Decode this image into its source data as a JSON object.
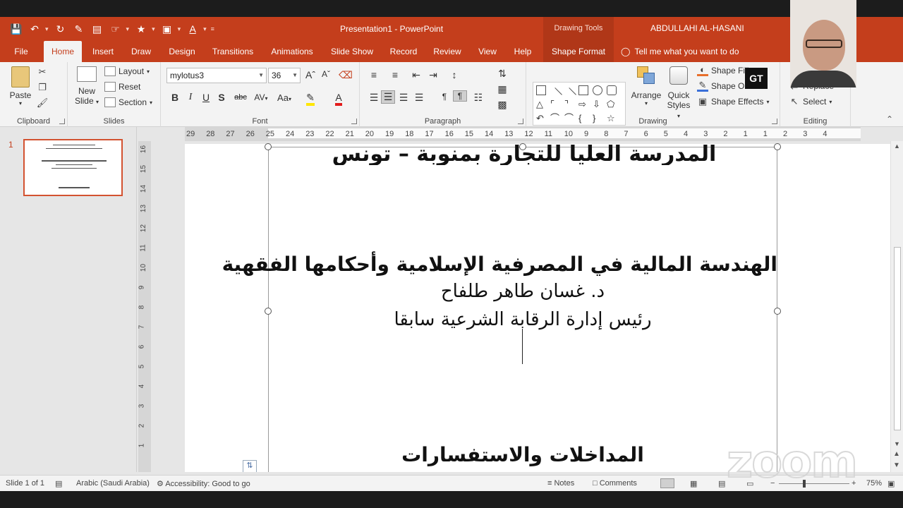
{
  "window": {
    "document_title": "Presentation1  -  PowerPoint",
    "contextual_header": "Drawing Tools",
    "user_name": "ABDULLAHI AL-HASANI"
  },
  "tabs": [
    "File",
    "Home",
    "Insert",
    "Draw",
    "Design",
    "Transitions",
    "Animations",
    "Slide Show",
    "Record",
    "Review",
    "View",
    "Help",
    "Shape Format"
  ],
  "tell_me": "Tell me what you want to do",
  "ribbon": {
    "clipboard": {
      "paste": "Paste",
      "label": "Clipboard"
    },
    "slides": {
      "new_slide": "New",
      "new_slide2": "Slide",
      "layout": "Layout",
      "reset": "Reset",
      "section": "Section",
      "label": "Slides"
    },
    "font": {
      "name": "mylotus3",
      "size": "36",
      "label": "Font",
      "bold": "B",
      "italic": "I",
      "underline": "U",
      "shadow": "S",
      "strike": "abc",
      "spacing": "AV",
      "case": "Aa"
    },
    "paragraph": {
      "label": "Paragraph"
    },
    "drawing": {
      "arrange": "Arrange",
      "quick_styles": "Quick",
      "quick_styles2": "Styles",
      "shape_fill": "Shape Fill",
      "shape_outline": "Shape Outline",
      "shape_effects": "Shape Effects",
      "label": "Drawing"
    },
    "editing": {
      "replace": "Replace",
      "select": "Select",
      "label": "Editing"
    }
  },
  "thumbnail": {
    "number": "1"
  },
  "ruler": {
    "labels": [
      "29",
      "28",
      "27",
      "26",
      "25",
      "24",
      "23",
      "22",
      "21",
      "20",
      "19",
      "18",
      "17",
      "16",
      "15",
      "14",
      "13",
      "12",
      "11",
      "10",
      "9",
      "8",
      "7",
      "6",
      "5",
      "4",
      "3",
      "2",
      "1",
      "1",
      "2",
      "3",
      "4"
    ],
    "vlabels": [
      "16",
      "15",
      "14",
      "13",
      "12",
      "11",
      "10",
      "9",
      "8",
      "7",
      "6",
      "5",
      "4",
      "3",
      "2",
      "1"
    ]
  },
  "slide": {
    "line1": "المدرسة العليا للتجارة بمنوبة – تونس",
    "title": "الهندسة المالية في المصرفية الإسلامية وأحكامها الفقهية",
    "author": "د. غسان طاهر طلفاح",
    "position": "رئيس إدارة الرقابة الشرعية سابقا",
    "footer": "المداخلات والاستفسارات"
  },
  "status": {
    "slide_of": "Slide 1 of 1",
    "language": "Arabic (Saudi Arabia)",
    "accessibility": "Accessibility: Good to go",
    "notes": "Notes",
    "comments": "Comments",
    "zoom": "75%"
  },
  "overlay": {
    "gt": "GT",
    "watermark": "zoom"
  },
  "colors": {
    "accent": "#c43e1c",
    "ribbon": "#f3f3f3"
  }
}
